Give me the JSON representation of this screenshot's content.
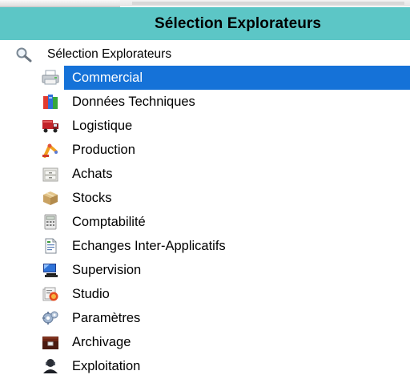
{
  "header": {
    "title": "Sélection Explorateurs"
  },
  "tree": {
    "root": {
      "label": "Sélection Explorateurs",
      "icon": "magnifier-icon"
    },
    "items": [
      {
        "label": "Commercial",
        "icon": "printer-icon",
        "selected": true
      },
      {
        "label": "Données Techniques",
        "icon": "books-icon"
      },
      {
        "label": "Logistique",
        "icon": "truck-icon"
      },
      {
        "label": "Production",
        "icon": "robot-arm-icon"
      },
      {
        "label": "Achats",
        "icon": "cabinet-icon"
      },
      {
        "label": "Stocks",
        "icon": "box-icon"
      },
      {
        "label": "Comptabilité",
        "icon": "calculator-icon"
      },
      {
        "label": "Echanges Inter-Applicatifs",
        "icon": "document-exchange-icon"
      },
      {
        "label": "Supervision",
        "icon": "monitor-icon"
      },
      {
        "label": "Studio",
        "icon": "studio-icon"
      },
      {
        "label": "Paramètres",
        "icon": "gears-icon"
      },
      {
        "label": "Archivage",
        "icon": "archive-chest-icon"
      },
      {
        "label": "Exploitation",
        "icon": "operator-icon"
      }
    ]
  },
  "colors": {
    "header_bg": "#5cc6c6",
    "selection_bg": "#1572d8",
    "selection_text": "#ffffff"
  }
}
